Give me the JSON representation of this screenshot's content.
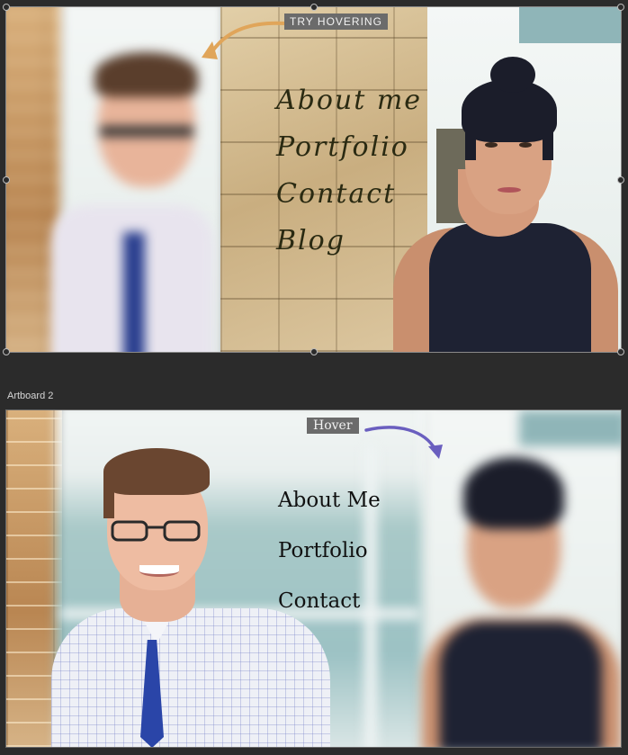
{
  "artboard1": {
    "hint_label": "TRY HOVERING",
    "menu": [
      "About me",
      "Portfolio",
      "Contact",
      "Blog"
    ]
  },
  "artboard2": {
    "title": "Artboard 2",
    "hint_label": "Hover",
    "menu": [
      "About Me",
      "Portfolio",
      "Contact"
    ]
  },
  "colors": {
    "canvas": "#2b2b2b",
    "arrow1": "#e0a55a",
    "arrow2": "#6a5fbf",
    "tag_bg": "#6b6b6b"
  }
}
